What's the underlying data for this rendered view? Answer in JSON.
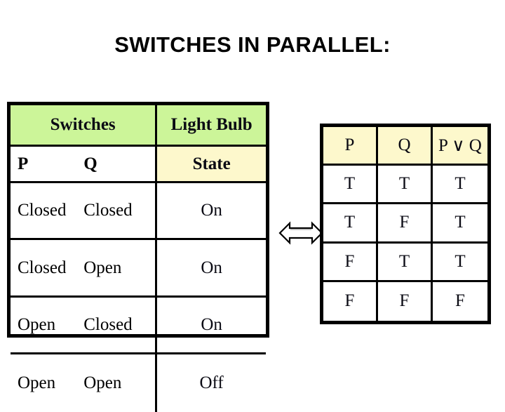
{
  "title": "SWITCHES IN PARALLEL:",
  "colors": {
    "header_green": "#ccf599",
    "header_cream": "#fdf8cc",
    "border": "#000000",
    "text": "#0b0b14",
    "page_background": "#ffffff"
  },
  "switch_table": {
    "group_headers": {
      "switches": "Switches",
      "light_bulb": "Light Bulb"
    },
    "column_headers": {
      "p": "P",
      "q": "Q",
      "state": "State"
    },
    "rows": [
      {
        "p": "Closed",
        "q": "Closed",
        "state": "On"
      },
      {
        "p": "Closed",
        "q": "Open",
        "state": "On"
      },
      {
        "p": "Open",
        "q": "Closed",
        "state": "On"
      },
      {
        "p": "Open",
        "q": "Open",
        "state": "Off"
      }
    ]
  },
  "truth_table": {
    "headers": [
      "P",
      "Q",
      "P ∨ Q"
    ],
    "rows": [
      [
        "T",
        "T",
        "T"
      ],
      [
        "T",
        "F",
        "T"
      ],
      [
        "F",
        "T",
        "T"
      ],
      [
        "F",
        "F",
        "F"
      ]
    ]
  },
  "arrow": {
    "icon": "double-headed-arrow-icon",
    "meaning": "equivalence"
  }
}
